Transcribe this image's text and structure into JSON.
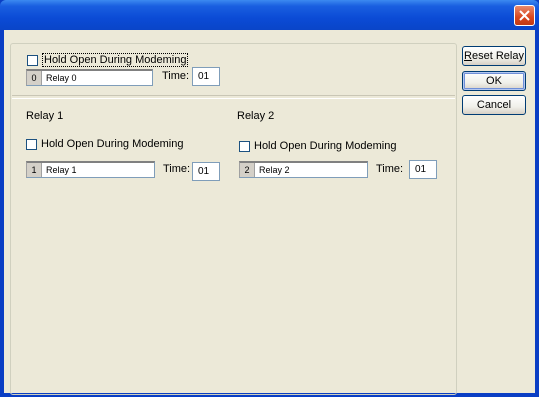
{
  "window": {
    "title": "",
    "close_icon": "close-icon"
  },
  "relay0": {
    "hold_open_label": "Hold Open During Modeming",
    "number": "0",
    "name": "Relay 0",
    "time_label": "Time:",
    "time_value": "01"
  },
  "relay1": {
    "section_label": "Relay 1",
    "hold_open_label": "Hold Open During Modeming",
    "number": "1",
    "name": "Relay 1",
    "time_label": "Time:",
    "time_value": "01"
  },
  "relay2": {
    "section_label": "Relay 2",
    "hold_open_label": "Hold Open During Modeming",
    "number": "2",
    "name": "Relay 2",
    "time_label": "Time:",
    "time_value": "01"
  },
  "buttons": {
    "reset_relay_mnemonic": "R",
    "reset_relay_rest": "eset Relay",
    "ok": "OK",
    "cancel": "Cancel"
  },
  "colors": {
    "titlebar": "#0b4bd6",
    "client": "#ece9d8",
    "close": "#d9461e"
  }
}
